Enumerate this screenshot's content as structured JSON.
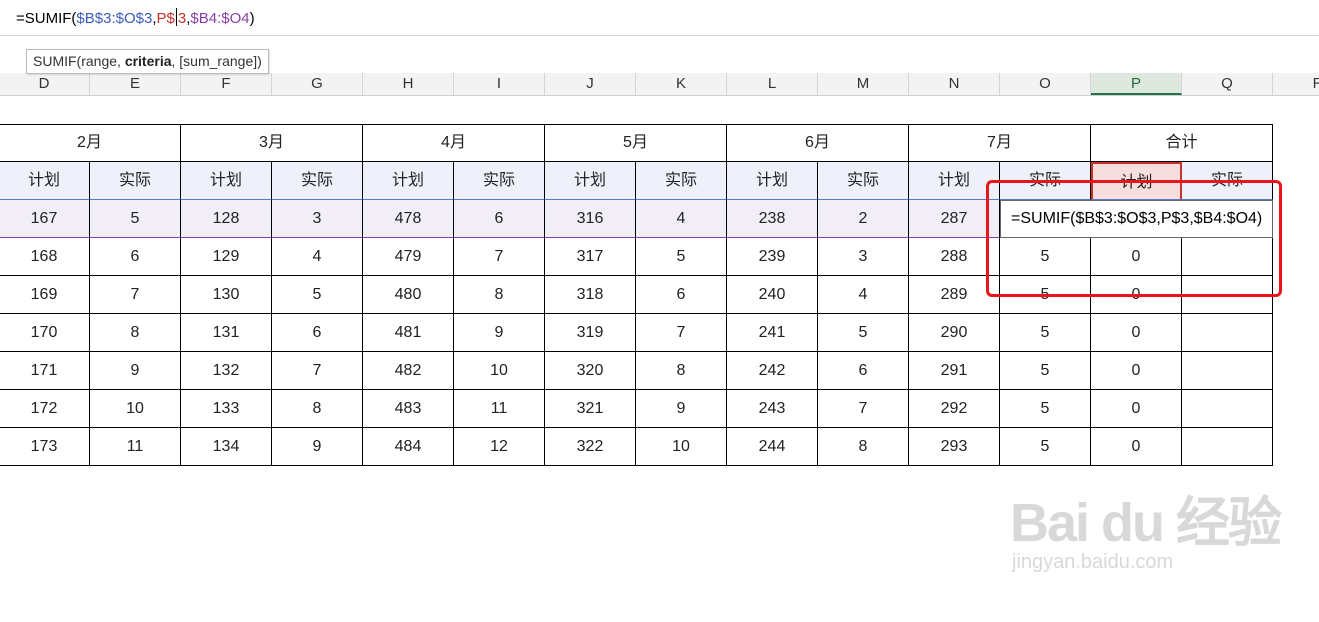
{
  "formula_bar": {
    "parts": [
      {
        "text": "=SUMIF(",
        "color": "black"
      },
      {
        "text": "$B$3:$O$3",
        "color": "blue"
      },
      {
        "text": ",",
        "color": "black"
      },
      {
        "text": "P$",
        "color": "red"
      },
      {
        "text": "3",
        "color": "red"
      },
      {
        "text": ",",
        "color": "black"
      },
      {
        "text": "$B4:$O4",
        "color": "purple"
      },
      {
        "text": ")",
        "color": "black"
      }
    ]
  },
  "tooltip": {
    "prefix": "SUMIF(range, ",
    "bold": "criteria",
    "suffix": ", [sum_range])"
  },
  "column_headers": [
    "D",
    "E",
    "F",
    "G",
    "H",
    "I",
    "J",
    "K",
    "L",
    "M",
    "N",
    "O",
    "P",
    "Q",
    "R"
  ],
  "active_column": "P",
  "months": [
    "2月",
    "3月",
    "4月",
    "5月",
    "6月",
    "7月",
    "合计"
  ],
  "sub_headers": [
    "计划",
    "实际",
    "计划",
    "实际",
    "计划",
    "实际",
    "计划",
    "实际",
    "计划",
    "实际",
    "计划",
    "实际",
    "计划",
    "实际"
  ],
  "editing_formula": "=SUMIF($B$3:$O$3,P$3,$B4:$O4)",
  "rows": [
    [
      "167",
      "5",
      "128",
      "3",
      "478",
      "6",
      "316",
      "4",
      "238",
      "2",
      "287",
      "",
      "",
      ""
    ],
    [
      "168",
      "6",
      "129",
      "4",
      "479",
      "7",
      "317",
      "5",
      "239",
      "3",
      "288",
      "5",
      "0",
      ""
    ],
    [
      "169",
      "7",
      "130",
      "5",
      "480",
      "8",
      "318",
      "6",
      "240",
      "4",
      "289",
      "5",
      "0",
      ""
    ],
    [
      "170",
      "8",
      "131",
      "6",
      "481",
      "9",
      "319",
      "7",
      "241",
      "5",
      "290",
      "5",
      "0",
      ""
    ],
    [
      "171",
      "9",
      "132",
      "7",
      "482",
      "10",
      "320",
      "8",
      "242",
      "6",
      "291",
      "5",
      "0",
      ""
    ],
    [
      "172",
      "10",
      "133",
      "8",
      "483",
      "11",
      "321",
      "9",
      "243",
      "7",
      "292",
      "5",
      "0",
      ""
    ],
    [
      "173",
      "11",
      "134",
      "9",
      "484",
      "12",
      "322",
      "10",
      "244",
      "8",
      "293",
      "5",
      "0",
      ""
    ]
  ],
  "watermark": {
    "main": "Bai du 经验",
    "sub": "jingyan.baidu.com"
  },
  "colors": {
    "accent_green": "#217346",
    "highlight_box": "#e8161c",
    "ref_blue": "#3b5bbd",
    "ref_red": "#c8312c",
    "ref_purple": "#8a3fa8"
  }
}
